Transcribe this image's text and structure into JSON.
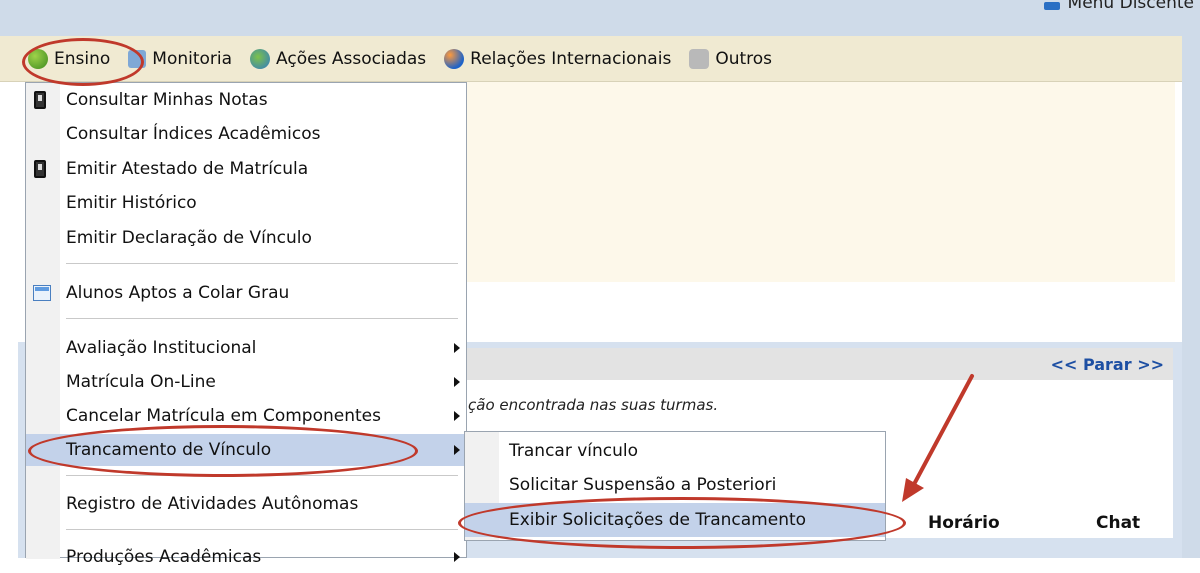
{
  "header": {
    "menu_discente": "Menu Discente"
  },
  "menubar": {
    "items": [
      {
        "label": "Ensino",
        "icon": "ensino-icon"
      },
      {
        "label": "Monitoria",
        "icon": "monitoria-icon"
      },
      {
        "label": "Ações Associadas",
        "icon": "acoes-associadas-icon"
      },
      {
        "label": "Relações Internacionais",
        "icon": "relacoes-internacionais-icon"
      },
      {
        "label": "Outros",
        "icon": "outros-icon"
      }
    ]
  },
  "dropdown": {
    "items": [
      {
        "label": "Consultar Minhas Notas",
        "icon": "phone-icon"
      },
      {
        "label": "Consultar Índices Acadêmicos"
      },
      {
        "label": "Emitir Atestado de Matrícula",
        "icon": "phone-icon"
      },
      {
        "label": "Emitir Histórico"
      },
      {
        "label": "Emitir Declaração de Vínculo"
      },
      {
        "label": "Alunos Aptos a Colar Grau",
        "icon": "table-icon"
      },
      {
        "label": "Avaliação Institucional",
        "submenu": true
      },
      {
        "label": "Matrícula On-Line",
        "submenu": true
      },
      {
        "label": "Cancelar Matrícula em Componentes",
        "submenu": true
      },
      {
        "label": "Trancamento de Vínculo",
        "submenu": true,
        "highlighted": true
      },
      {
        "label": "Registro de Atividades Autônomas"
      },
      {
        "label": "Produções Acadêmicas",
        "submenu": true
      }
    ]
  },
  "submenu": {
    "items": [
      {
        "label": "Trancar vínculo"
      },
      {
        "label": "Solicitar Suspensão a Posteriori"
      },
      {
        "label": "Exibir Solicitações de Trancamento",
        "highlighted": true
      }
    ]
  },
  "content": {
    "parar": "<< Parar >>",
    "message": "ção encontrada nas suas turmas.",
    "columns": [
      "Horário",
      "Chat"
    ]
  },
  "colors": {
    "menubar_bg": "#f0ead2",
    "highlight": "#c3d2ea",
    "annotation_red": "#c0392b",
    "link_blue": "#1d4fa3"
  }
}
